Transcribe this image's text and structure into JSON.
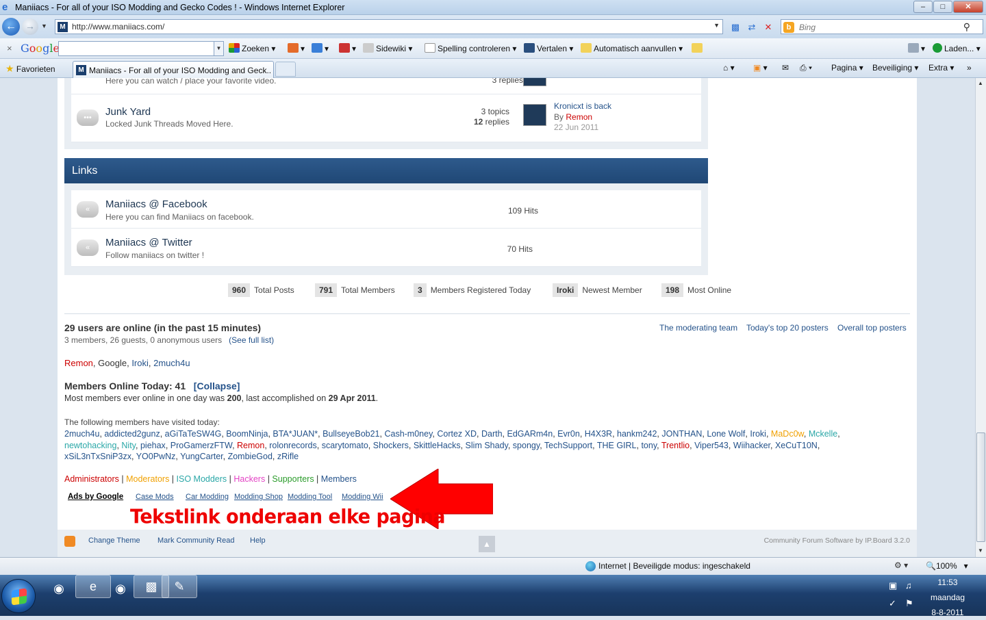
{
  "window": {
    "title": "Maniiacs - For all of your ISO Modding and Gecko Codes ! - Windows Internet Explorer",
    "min": "–",
    "max": "□",
    "close": "✕"
  },
  "address": {
    "url": "http://www.maniiacs.com/",
    "search_placeholder": "Bing"
  },
  "google_toolbar": {
    "close": "×",
    "logo": "Google",
    "search": "Zoeken",
    "sidewiki": "Sidewiki",
    "spelling": "Spelling controleren",
    "translate": "Vertalen",
    "autofill": "Automatisch aanvullen",
    "loading": "Laden..."
  },
  "favbar": {
    "favorites": "Favorieten",
    "tab_title": "Maniiacs - For all of your ISO Modding and Geck...",
    "page": "Pagina",
    "security": "Beveiliging",
    "extra": "Extra"
  },
  "forum_rows": [
    {
      "title": "Junk Yard",
      "desc": "Locked Junk Threads Moved Here.",
      "topics_n": "3",
      "topics_label": "topics",
      "replies_n": "12",
      "replies_label": "replies",
      "last_title": "Kronicxt is back",
      "by": "By",
      "last_user": "Remon",
      "last_date": "22 Jun 2011"
    }
  ],
  "partial_row_desc": "Here you can watch / place your favorite video.",
  "partial_row_stats": "3 replies",
  "links_section": {
    "title": "Links",
    "items": [
      {
        "title": "Maniiacs @ Facebook",
        "desc": "Here you can find Maniiacs on facebook.",
        "hits": "109 Hits"
      },
      {
        "title": "Maniiacs @ Twitter",
        "desc": "Follow maniiacs on twitter !",
        "hits": "70 Hits"
      }
    ]
  },
  "board_stats": [
    {
      "num": "960",
      "label": "Total Posts"
    },
    {
      "num": "791",
      "label": "Total Members"
    },
    {
      "num": "3",
      "label": "Members Registered Today"
    },
    {
      "num": "Iroki",
      "label": "Newest Member"
    },
    {
      "num": "198",
      "label": "Most Online"
    }
  ],
  "online": {
    "heading": "29 users are online (in the past 15 minutes)",
    "summary": "3 members, 26 guests, 0 anonymous users",
    "full_list": "(See full list)",
    "links": [
      "The moderating team",
      "Today's top 20 posters",
      "Overall top posters"
    ],
    "users": [
      {
        "name": "Remon",
        "color": "#cc0000"
      },
      {
        "name": "Google",
        "color": "#333333"
      },
      {
        "name": "Iroki",
        "color": "#24528a"
      },
      {
        "name": "2much4u",
        "color": "#24528a"
      }
    ],
    "today_heading": "Members Online Today: 41",
    "collapse": "[Collapse]",
    "record_1": "Most members ever online in one day was ",
    "record_num": "200",
    "record_2": ", last accomplished on ",
    "record_date": "29 Apr 2011",
    "record_end": ".",
    "visited_label": "The following members have visited today:",
    "visited_lines": [
      [
        {
          "n": "2much4u",
          "c": "#24528a"
        },
        {
          "n": "addicted2gunz",
          "c": "#24528a"
        },
        {
          "n": "aGiTaTeSW4G",
          "c": "#24528a"
        },
        {
          "n": "BoomNinja",
          "c": "#24528a"
        },
        {
          "n": "BTA*JUAN*",
          "c": "#24528a"
        },
        {
          "n": "BullseyeBob21",
          "c": "#24528a"
        },
        {
          "n": "Cash-m0ney",
          "c": "#24528a"
        },
        {
          "n": "Cortez XD",
          "c": "#24528a"
        },
        {
          "n": "Darth",
          "c": "#24528a"
        },
        {
          "n": "EdGARm4n",
          "c": "#24528a"
        },
        {
          "n": "Evr0n",
          "c": "#24528a"
        },
        {
          "n": "H4X3R",
          "c": "#24528a"
        },
        {
          "n": "hankm242",
          "c": "#24528a"
        },
        {
          "n": "JONTHAN",
          "c": "#24528a"
        },
        {
          "n": "Lone Wolf",
          "c": "#24528a"
        },
        {
          "n": "Iroki",
          "c": "#24528a"
        },
        {
          "n": "MaDc0w",
          "c": "#f0a000"
        },
        {
          "n": "Mckelle",
          "c": "#2aa7a7"
        }
      ],
      [
        {
          "n": "newtohacking",
          "c": "#2aa7a7"
        },
        {
          "n": "Nity",
          "c": "#2aa7a7"
        },
        {
          "n": "piehax",
          "c": "#24528a"
        },
        {
          "n": "ProGamerzFTW",
          "c": "#24528a"
        },
        {
          "n": "Remon",
          "c": "#cc0000"
        },
        {
          "n": "rolonrecords",
          "c": "#24528a"
        },
        {
          "n": "scarytomato",
          "c": "#24528a"
        },
        {
          "n": "Shockers",
          "c": "#24528a"
        },
        {
          "n": "SkittleHacks",
          "c": "#24528a"
        },
        {
          "n": "Slim Shady",
          "c": "#24528a"
        },
        {
          "n": "spongy",
          "c": "#24528a"
        },
        {
          "n": "TechSupport",
          "c": "#24528a"
        },
        {
          "n": "THE GIRL",
          "c": "#24528a"
        },
        {
          "n": "tony",
          "c": "#24528a"
        },
        {
          "n": "Trentlio",
          "c": "#cc0000"
        },
        {
          "n": "Viper543",
          "c": "#24528a"
        },
        {
          "n": "Wiihacker",
          "c": "#24528a"
        },
        {
          "n": "XeCuT10N",
          "c": "#24528a"
        }
      ],
      [
        {
          "n": "xSiL3nTxSniP3zx",
          "c": "#24528a"
        },
        {
          "n": "YO0PwNz",
          "c": "#24528a"
        },
        {
          "n": "YungCarter",
          "c": "#24528a"
        },
        {
          "n": "ZombieGod",
          "c": "#24528a"
        },
        {
          "n": "zRifle",
          "c": "#24528a"
        }
      ]
    ],
    "groups": [
      {
        "name": "Administrators",
        "color": "#cc0000"
      },
      {
        "name": "Moderators",
        "color": "#f0a000"
      },
      {
        "name": "ISO Modders",
        "color": "#2aa7a7"
      },
      {
        "name": "Hackers",
        "color": "#e342c4"
      },
      {
        "name": "Supporters",
        "color": "#2a9b2a"
      },
      {
        "name": "Members",
        "color": "#24528a"
      }
    ]
  },
  "ads": {
    "label": "Ads by Google",
    "links": [
      "Case Mods",
      "Car Modding",
      "Modding Shop",
      "Modding Tool",
      "Modding Wii"
    ]
  },
  "annotation": "Tekstlink onderaan elke pagina",
  "footer": {
    "links": [
      "Change Theme",
      "Mark Community Read",
      "Help"
    ],
    "credit": "Community Forum Software by IP.Board 3.2.0"
  },
  "status": {
    "zone": "Internet | Beveiligde modus: ingeschakeld",
    "zoom": "100%"
  },
  "taskbar": {
    "time": "11:53",
    "day": "maandag",
    "date": "8-8-2011"
  }
}
